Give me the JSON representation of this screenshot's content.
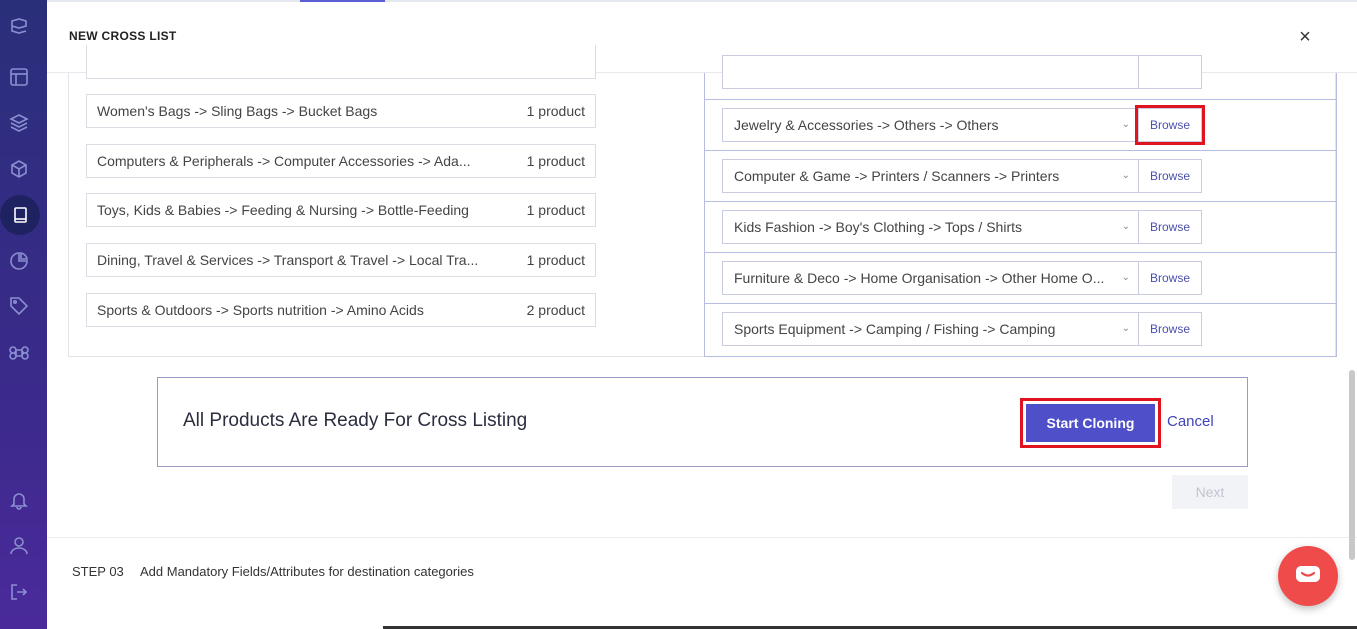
{
  "modal": {
    "title": "NEW CROSS LIST",
    "close_icon": "×"
  },
  "sidebar": {
    "icons": [
      "logo-icon",
      "layout-icon",
      "layers-icon",
      "box-icon",
      "book-icon",
      "pie-chart-icon",
      "tag-icon",
      "command-icon",
      "bell-icon",
      "user-icon",
      "logout-icon"
    ]
  },
  "source_categories": [
    {
      "label": "Women's Bags -> Sling Bags -> Bucket Bags",
      "count": "1 product"
    },
    {
      "label": "Computers & Peripherals -> Computer Accessories -> Ada...",
      "count": "1 product"
    },
    {
      "label": "Toys, Kids & Babies -> Feeding & Nursing -> Bottle-Feeding",
      "count": "1 product"
    },
    {
      "label": "Dining, Travel & Services -> Transport & Travel -> Local Tra...",
      "count": "1 product"
    },
    {
      "label": "Sports & Outdoors -> Sports nutrition -> Amino Acids",
      "count": "2 product"
    }
  ],
  "destination_categories": [
    {
      "value": "Jewelry & Accessories -> Others -> Others",
      "browse": "Browse"
    },
    {
      "value": "Computer & Game -> Printers / Scanners -> Printers",
      "browse": "Browse"
    },
    {
      "value": "Kids Fashion -> Boy's Clothing -> Tops / Shirts",
      "browse": "Browse"
    },
    {
      "value": "Furniture & Deco -> Home Organisation -> Other Home O...",
      "browse": "Browse"
    },
    {
      "value": "Sports Equipment -> Camping / Fishing -> Camping",
      "browse": "Browse"
    }
  ],
  "banner": {
    "text": "All Products Are Ready For Cross Listing",
    "start_label": "Start Cloning",
    "cancel_label": "Cancel"
  },
  "next_label": "Next",
  "step": {
    "number": "STEP 03",
    "text": "Add Mandatory Fields/Attributes for destination categories"
  },
  "colors": {
    "accent": "#4e4fc9",
    "highlight": "#e0141e",
    "chat": "#f04b4b",
    "sidebar": "#2a2f7a"
  }
}
